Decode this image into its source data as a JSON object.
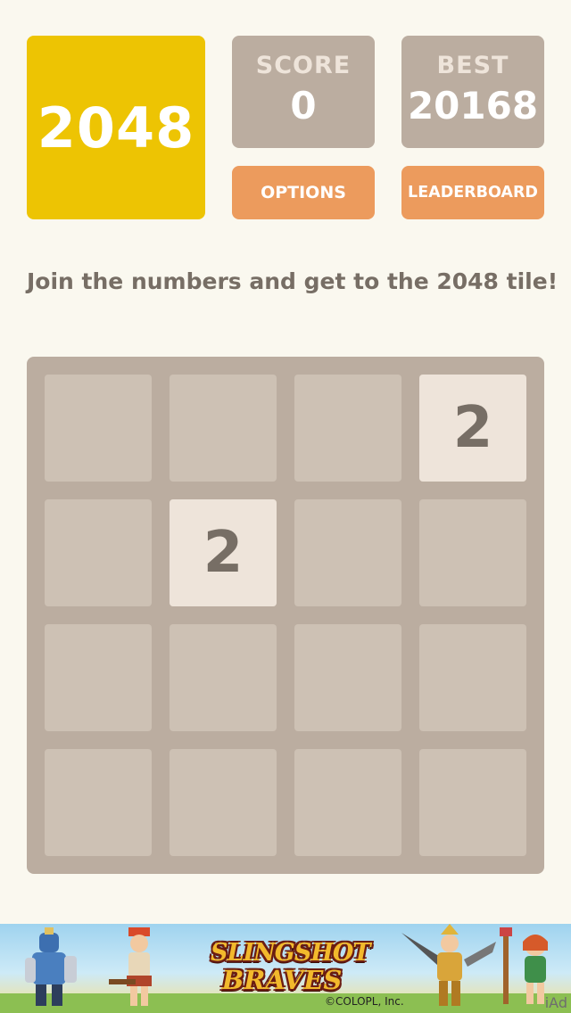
{
  "header": {
    "logo": "2048",
    "score_label": "SCORE",
    "score_value": "0",
    "best_label": "BEST",
    "best_value": "20168",
    "options_label": "OPTIONS",
    "leaderboard_label": "LEADERBOARD"
  },
  "tagline": "Join the numbers and get to the 2048 tile!",
  "board": {
    "grid": [
      [
        null,
        null,
        null,
        2
      ],
      [
        null,
        2,
        null,
        null
      ],
      [
        null,
        null,
        null,
        null
      ],
      [
        null,
        null,
        null,
        null
      ]
    ],
    "tile_2_label": "2"
  },
  "ad": {
    "title_line1": "SLINGSHOT",
    "title_line2": "BRAVES",
    "copyright": "©COLOPL, Inc.",
    "iad_label": "iAd"
  },
  "colors": {
    "background": "#faf8ef",
    "logo_tile": "#edc403",
    "score_box": "#bbada0",
    "button": "#ec9b5d",
    "board": "#bbada0",
    "empty_cell": "#cdc1b4",
    "tile_2": "#eee4da",
    "dark_text": "#776e65"
  }
}
